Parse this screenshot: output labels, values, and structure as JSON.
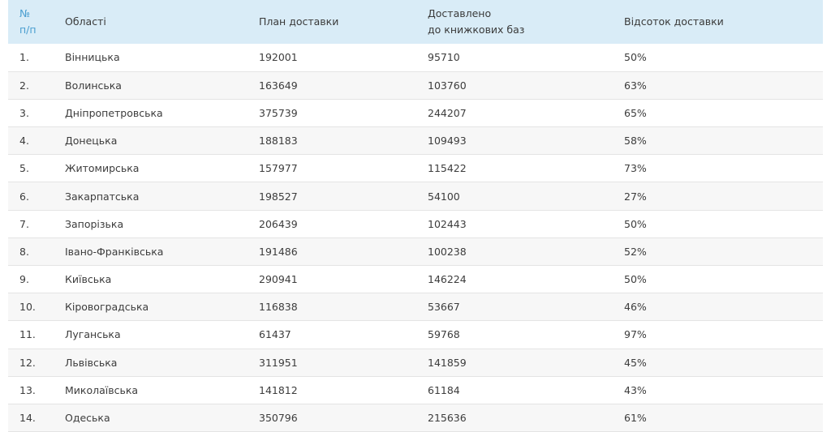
{
  "table": {
    "headers": {
      "num_line1": "№",
      "num_line2": "п/п",
      "region": "Області",
      "plan": "План доставки",
      "delivered_line1": "Доставлено",
      "delivered_line2": "до книжкових баз",
      "percent": "Відсоток доставки"
    },
    "rows": [
      {
        "num": "1.",
        "region": "Вінницька",
        "plan": "192001",
        "delivered": "95710",
        "percent": "50%"
      },
      {
        "num": "2.",
        "region": "Волинська",
        "plan": "163649",
        "delivered": "103760",
        "percent": "63%"
      },
      {
        "num": "3.",
        "region": "Дніпропетровська",
        "plan": "375739",
        "delivered": "244207",
        "percent": "65%"
      },
      {
        "num": "4.",
        "region": "Донецька",
        "plan": "188183",
        "delivered": "109493",
        "percent": "58%"
      },
      {
        "num": "5.",
        "region": "Житомирська",
        "plan": "157977",
        "delivered": "115422",
        "percent": "73%"
      },
      {
        "num": "6.",
        "region": "Закарпатська",
        "plan": "198527",
        "delivered": "54100",
        "percent": "27%"
      },
      {
        "num": "7.",
        "region": "Запорізька",
        "plan": "206439",
        "delivered": "102443",
        "percent": "50%"
      },
      {
        "num": "8.",
        "region": "Івано-Франківська",
        "plan": "191486",
        "delivered": "100238",
        "percent": "52%"
      },
      {
        "num": "9.",
        "region": "Київська",
        "plan": "290941",
        "delivered": "146224",
        "percent": "50%"
      },
      {
        "num": "10.",
        "region": "Кіровоградська",
        "plan": "116838",
        "delivered": "53667",
        "percent": "46%"
      },
      {
        "num": "11.",
        "region": "Луганська",
        "plan": "61437",
        "delivered": "59768",
        "percent": "97%"
      },
      {
        "num": "12.",
        "region": "Львівська",
        "plan": "311951",
        "delivered": "141859",
        "percent": "45%"
      },
      {
        "num": "13.",
        "region": "Миколаївська",
        "plan": "141812",
        "delivered": "61184",
        "percent": "43%"
      },
      {
        "num": "14.",
        "region": "Одеська",
        "plan": "350796",
        "delivered": "215636",
        "percent": "61%"
      }
    ]
  }
}
